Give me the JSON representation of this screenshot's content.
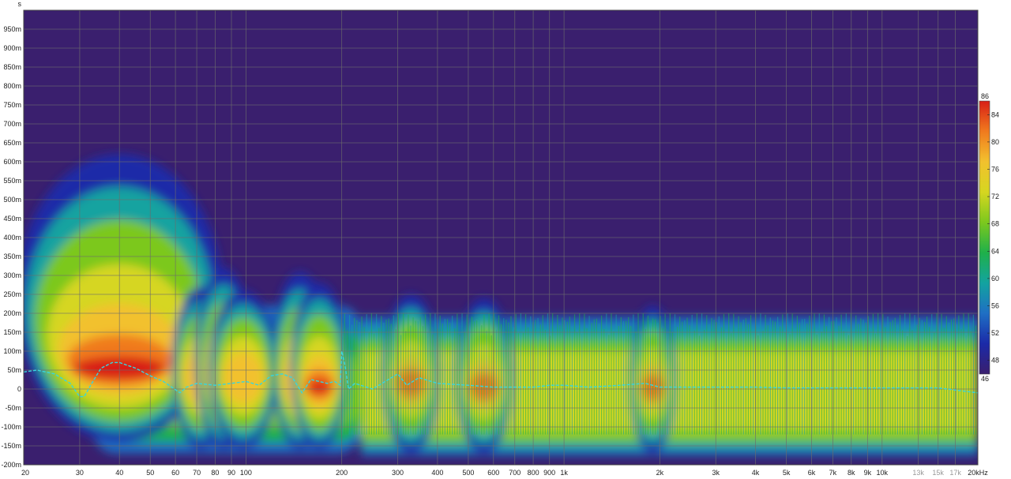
{
  "chart_data": {
    "type": "heatmap",
    "title": "",
    "ylabel": "s",
    "xlabel": "",
    "x_scale": "log",
    "xlim": [
      20,
      20000
    ],
    "ylim": [
      -0.2,
      1.0
    ],
    "grid": true,
    "background_color": "#3a1f6e",
    "grid_color": "#6c6c6c",
    "y_ticks": [
      {
        "value": 0.95,
        "label": "950m"
      },
      {
        "value": 0.9,
        "label": "900m"
      },
      {
        "value": 0.85,
        "label": "850m"
      },
      {
        "value": 0.8,
        "label": "800m"
      },
      {
        "value": 0.75,
        "label": "750m"
      },
      {
        "value": 0.7,
        "label": "700m"
      },
      {
        "value": 0.65,
        "label": "650m"
      },
      {
        "value": 0.6,
        "label": "600m"
      },
      {
        "value": 0.55,
        "label": "550m"
      },
      {
        "value": 0.5,
        "label": "500m"
      },
      {
        "value": 0.45,
        "label": "450m"
      },
      {
        "value": 0.4,
        "label": "400m"
      },
      {
        "value": 0.35,
        "label": "350m"
      },
      {
        "value": 0.3,
        "label": "300m"
      },
      {
        "value": 0.25,
        "label": "250m"
      },
      {
        "value": 0.2,
        "label": "200m"
      },
      {
        "value": 0.15,
        "label": "150m"
      },
      {
        "value": 0.1,
        "label": "100m"
      },
      {
        "value": 0.05,
        "label": "50m"
      },
      {
        "value": 0.0,
        "label": "0"
      },
      {
        "value": -0.05,
        "label": "-50m"
      },
      {
        "value": -0.1,
        "label": "-100m"
      },
      {
        "value": -0.15,
        "label": "-150m"
      },
      {
        "value": -0.2,
        "label": "-200m"
      }
    ],
    "x_ticks": [
      {
        "value": 20,
        "label": "20",
        "major": true
      },
      {
        "value": 30,
        "label": "30",
        "major": true
      },
      {
        "value": 40,
        "label": "40",
        "major": true
      },
      {
        "value": 50,
        "label": "50",
        "major": true
      },
      {
        "value": 60,
        "label": "60",
        "major": true
      },
      {
        "value": 70,
        "label": "70",
        "major": true
      },
      {
        "value": 80,
        "label": "80",
        "major": true
      },
      {
        "value": 90,
        "label": "90",
        "major": true
      },
      {
        "value": 100,
        "label": "100",
        "major": true
      },
      {
        "value": 200,
        "label": "200",
        "major": true
      },
      {
        "value": 300,
        "label": "300",
        "major": true
      },
      {
        "value": 400,
        "label": "400",
        "major": true
      },
      {
        "value": 500,
        "label": "500",
        "major": true
      },
      {
        "value": 600,
        "label": "600",
        "major": true
      },
      {
        "value": 700,
        "label": "700",
        "major": true
      },
      {
        "value": 800,
        "label": "800",
        "major": true
      },
      {
        "value": 900,
        "label": "900",
        "major": true
      },
      {
        "value": 1000,
        "label": "1k",
        "major": true
      },
      {
        "value": 2000,
        "label": "2k",
        "major": true
      },
      {
        "value": 3000,
        "label": "3k",
        "major": true
      },
      {
        "value": 4000,
        "label": "4k",
        "major": true
      },
      {
        "value": 5000,
        "label": "5k",
        "major": true
      },
      {
        "value": 6000,
        "label": "6k",
        "major": true
      },
      {
        "value": 7000,
        "label": "7k",
        "major": true
      },
      {
        "value": 8000,
        "label": "8k",
        "major": true
      },
      {
        "value": 9000,
        "label": "9k",
        "major": true
      },
      {
        "value": 10000,
        "label": "10k",
        "major": true
      },
      {
        "value": 13000,
        "label": "13k",
        "major": false
      },
      {
        "value": 15000,
        "label": "15k",
        "major": false
      },
      {
        "value": 17000,
        "label": "17k",
        "major": false
      },
      {
        "value": 20000,
        "label": "20kHz",
        "major": true
      }
    ],
    "colorbar": {
      "min": 46,
      "max": 86,
      "ticks": [
        84,
        80,
        76,
        72,
        68,
        64,
        60,
        56,
        52,
        48
      ],
      "max_label": "86",
      "min_label": "46",
      "colors": [
        "#3a1f6e",
        "#1b2aa8",
        "#1f6fc4",
        "#13a3a0",
        "#1fb04a",
        "#7cc81e",
        "#d6d620",
        "#f2c12e",
        "#f07a1e",
        "#d81f16"
      ]
    },
    "decay_blobs": [
      {
        "f": 40,
        "t_top": 0.62,
        "t_bottom": -0.14,
        "peak": 84,
        "t_peak": 0.04,
        "width": 0.18
      },
      {
        "f": 72,
        "t_top": 0.27,
        "t_bottom": -0.16,
        "peak": 76,
        "t_peak": 0.02,
        "width": 0.05
      },
      {
        "f": 85,
        "t_top": 0.32,
        "t_bottom": -0.16,
        "peak": 78,
        "t_peak": 0.02,
        "width": 0.05
      },
      {
        "f": 98,
        "t_top": 0.26,
        "t_bottom": -0.16,
        "peak": 79,
        "t_peak": 0.02,
        "width": 0.06
      },
      {
        "f": 148,
        "t_top": 0.31,
        "t_bottom": -0.16,
        "peak": 78,
        "t_peak": 0.0,
        "width": 0.05
      },
      {
        "f": 170,
        "t_top": 0.28,
        "t_bottom": -0.16,
        "peak": 84,
        "t_peak": 0.0,
        "width": 0.05
      },
      {
        "f": 330,
        "t_top": 0.25,
        "t_bottom": -0.17,
        "peak": 80,
        "t_peak": 0.01,
        "width": 0.05
      },
      {
        "f": 560,
        "t_top": 0.24,
        "t_bottom": -0.17,
        "peak": 82,
        "t_peak": 0.0,
        "width": 0.05
      },
      {
        "f": 1900,
        "t_top": 0.22,
        "t_bottom": -0.17,
        "peak": 82,
        "t_peak": 0.0,
        "width": 0.04
      }
    ],
    "series": [
      {
        "type": "line",
        "style": "dashed",
        "color": "#36d6e0",
        "x": [
          20,
          22,
          25,
          28,
          30,
          31,
          33,
          35,
          38,
          40,
          45,
          50,
          55,
          62,
          65,
          70,
          80,
          90,
          100,
          110,
          120,
          130,
          140,
          150,
          160,
          170,
          180,
          190,
          198,
          200,
          205,
          210,
          220,
          250,
          300,
          320,
          350,
          400,
          500,
          600,
          700,
          800,
          900,
          1000,
          1200,
          1500,
          1800,
          2000,
          2500,
          3000,
          4000,
          5000,
          7000,
          10000,
          15000,
          20000
        ],
        "y": [
          0.045,
          0.05,
          0.04,
          0.015,
          -0.02,
          -0.02,
          0.02,
          0.055,
          0.07,
          0.07,
          0.055,
          0.035,
          0.02,
          -0.01,
          0.005,
          0.015,
          0.01,
          0.015,
          0.02,
          0.01,
          0.035,
          0.04,
          0.03,
          -0.01,
          0.025,
          0.02,
          0.015,
          0.02,
          0.01,
          0.1,
          0.06,
          0.0,
          0.015,
          0.0,
          0.04,
          0.01,
          0.03,
          0.015,
          0.01,
          0.005,
          0.005,
          0.005,
          0.01,
          0.01,
          0.005,
          0.01,
          0.015,
          0.005,
          0.005,
          0.005,
          0.005,
          0.003,
          0.003,
          0.003,
          0.003,
          -0.01
        ]
      }
    ]
  }
}
